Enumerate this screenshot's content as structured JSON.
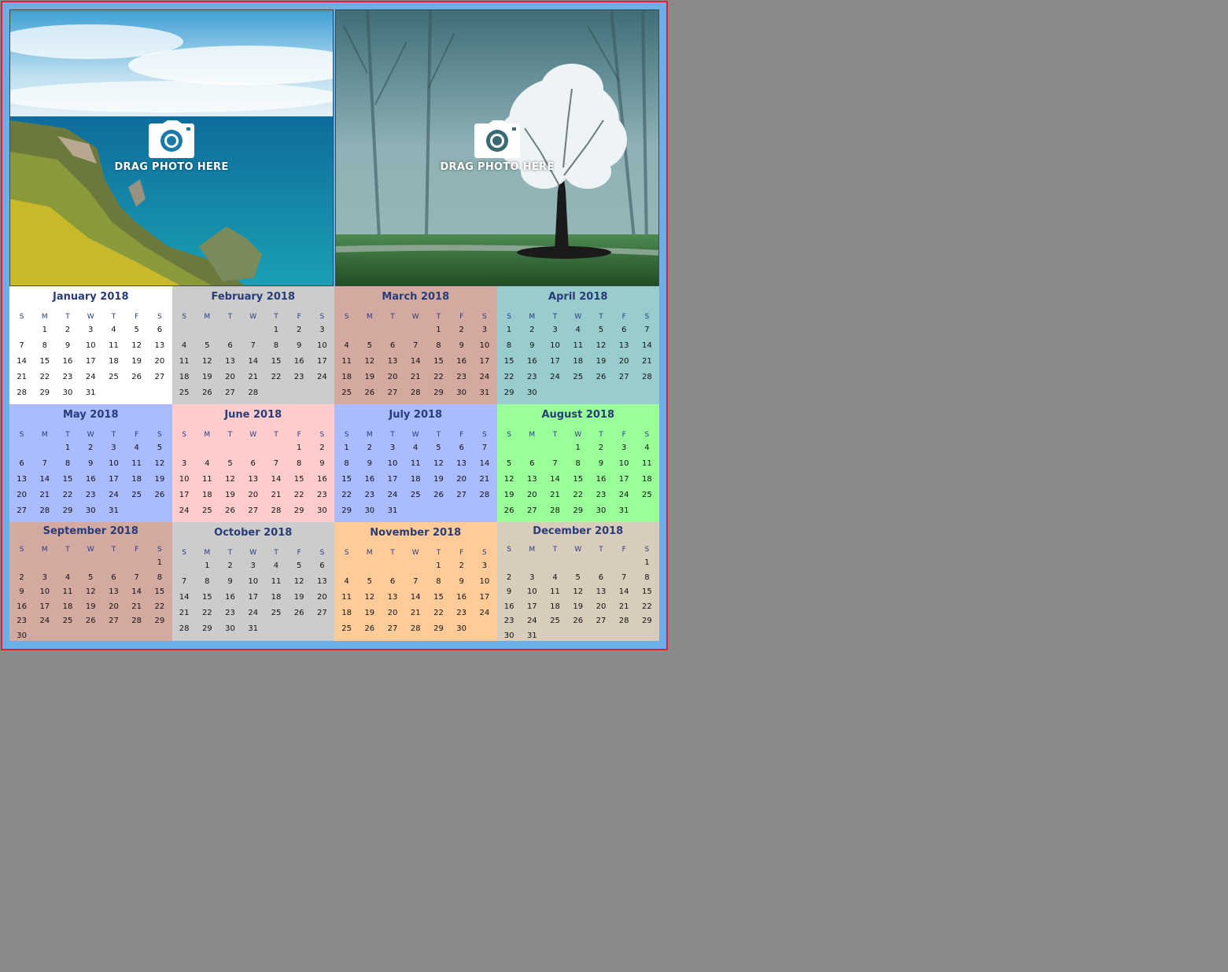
{
  "photos": [
    {
      "name": "coastal-cliffs-photo",
      "drop_label": "DRAG PHOTO HERE",
      "icon": "camera-icon"
    },
    {
      "name": "foggy-blossom-tree-photo",
      "drop_label": "DRAG PHOTO HERE",
      "icon": "camera-icon"
    }
  ],
  "weekdays": [
    "S",
    "M",
    "T",
    "W",
    "T",
    "F",
    "S"
  ],
  "months": [
    {
      "title": "January 2018",
      "start": 1,
      "days": 31,
      "bg": "#ffffff"
    },
    {
      "title": "February 2018",
      "start": 4,
      "days": 28,
      "bg": "#cccccc"
    },
    {
      "title": "March 2018",
      "start": 4,
      "days": 31,
      "bg": "#d4aaa0"
    },
    {
      "title": "April 2018",
      "start": 0,
      "days": 30,
      "bg": "#99cccc"
    },
    {
      "title": "May 2018",
      "start": 2,
      "days": 31,
      "bg": "#aabbff"
    },
    {
      "title": "June 2018",
      "start": 5,
      "days": 30,
      "bg": "#ffcccc"
    },
    {
      "title": "July 2018",
      "start": 0,
      "days": 31,
      "bg": "#aabbff"
    },
    {
      "title": "August 2018",
      "start": 3,
      "days": 31,
      "bg": "#99ff99"
    },
    {
      "title": "September 2018",
      "start": 6,
      "days": 30,
      "bg": "#d4aaa0"
    },
    {
      "title": "October 2018",
      "start": 1,
      "days": 31,
      "bg": "#cccccc"
    },
    {
      "title": "November 2018",
      "start": 4,
      "days": 30,
      "bg": "#ffcc99"
    },
    {
      "title": "December 2018",
      "start": 6,
      "days": 31,
      "bg": "#d8ccbb"
    }
  ]
}
